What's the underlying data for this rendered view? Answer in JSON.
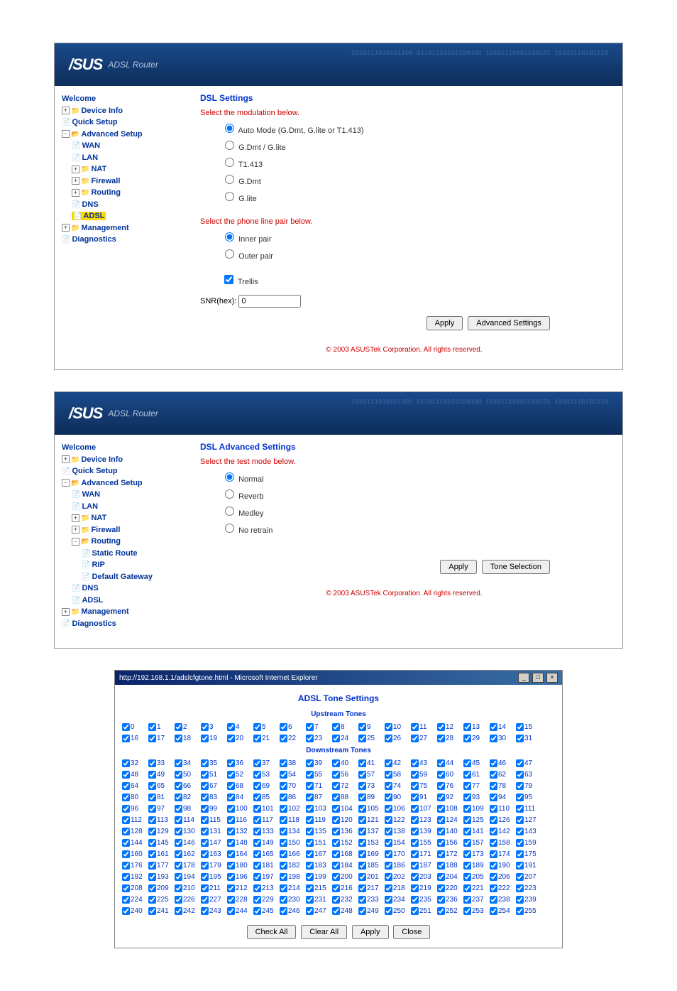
{
  "logo": {
    "brand": "/SUS",
    "product": "ADSL Router"
  },
  "binary_decor": "1010111010101100\n01101110101100100\n10101110101100101\n10101110101110",
  "copyright": "© 2003 ASUSTek Corporation. All rights reserved.",
  "panel1": {
    "nav": {
      "welcome": "Welcome",
      "device_info": "Device Info",
      "quick_setup": "Quick Setup",
      "advanced_setup": "Advanced Setup",
      "wan": "WAN",
      "lan": "LAN",
      "nat": "NAT",
      "firewall": "Firewall",
      "routing": "Routing",
      "dns": "DNS",
      "adsl": "ADSL",
      "management": "Management",
      "diagnostics": "Diagnostics"
    },
    "title": "DSL Settings",
    "modulation_label": "Select the modulation below.",
    "modulation": {
      "auto": "Auto Mode (G.Dmt, G.lite or T1.413)",
      "gdmt_glite": "G.Dmt / G.lite",
      "t1413": "T1.413",
      "gdmt": "G.Dmt",
      "glite": "G.lite"
    },
    "phone_pair_label": "Select the phone line pair below.",
    "inner": "Inner pair",
    "outer": "Outer pair",
    "trellis": "Trellis",
    "snr_label": "SNR(hex):",
    "snr_value": "0",
    "apply": "Apply",
    "advanced": "Advanced Settings"
  },
  "panel2": {
    "nav": {
      "welcome": "Welcome",
      "device_info": "Device Info",
      "quick_setup": "Quick Setup",
      "advanced_setup": "Advanced Setup",
      "wan": "WAN",
      "lan": "LAN",
      "nat": "NAT",
      "firewall": "Firewall",
      "routing": "Routing",
      "static_route": "Static Route",
      "rip": "RIP",
      "default_gateway": "Default Gateway",
      "dns": "DNS",
      "adsl": "ADSL",
      "management": "Management",
      "diagnostics": "Diagnostics"
    },
    "title": "DSL Advanced Settings",
    "test_mode_label": "Select the test mode below.",
    "normal": "Normal",
    "reverb": "Reverb",
    "medley": "Medley",
    "no_retrain": "No retrain",
    "apply": "Apply",
    "tone_selection": "Tone Selection"
  },
  "tone_popup": {
    "window_title": "http://192.168.1.1/adslcfgtone.html - Microsoft Internet Explorer",
    "title": "ADSL Tone Settings",
    "upstream": "Upstream Tones",
    "downstream": "Downstream Tones",
    "upstream_range": [
      0,
      31
    ],
    "downstream_range": [
      32,
      255
    ],
    "check_all": "Check All",
    "clear_all": "Clear All",
    "apply": "Apply",
    "close": "Close"
  }
}
